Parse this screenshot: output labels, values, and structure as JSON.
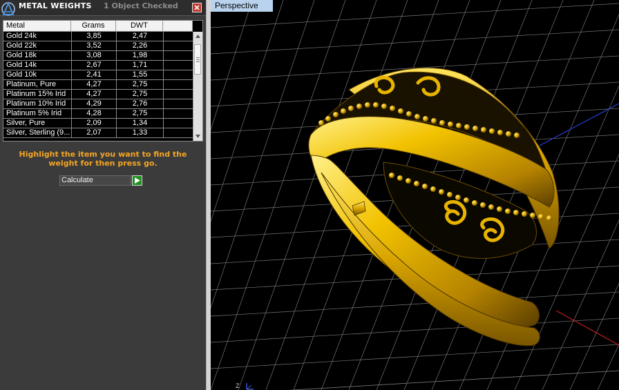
{
  "panel": {
    "title": "METAL WEIGHTS",
    "status": "1 Object Checked",
    "columns": [
      "Metal",
      "Grams",
      "DWT"
    ],
    "rows": [
      {
        "metal": "Gold 24k",
        "grams": "3,85",
        "dwt": "2,47"
      },
      {
        "metal": "Gold 22k",
        "grams": "3,52",
        "dwt": "2,26"
      },
      {
        "metal": "Gold 18k",
        "grams": "3,08",
        "dwt": "1,98"
      },
      {
        "metal": "Gold 14k",
        "grams": "2,67",
        "dwt": "1,71"
      },
      {
        "metal": "Gold 10k",
        "grams": "2,41",
        "dwt": "1,55"
      },
      {
        "metal": "Platinum, Pure",
        "grams": "4,27",
        "dwt": "2,75"
      },
      {
        "metal": "Platinum 15% Irid",
        "grams": "4,27",
        "dwt": "2,75"
      },
      {
        "metal": "Platinum 10% Irid",
        "grams": "4,29",
        "dwt": "2,76"
      },
      {
        "metal": "Platinum 5% Irid",
        "grams": "4,28",
        "dwt": "2,75"
      },
      {
        "metal": "Silver, Pure",
        "grams": "2,09",
        "dwt": "1,34"
      },
      {
        "metal": "Silver, Sterling (9...",
        "grams": "2,07",
        "dwt": "1,33"
      }
    ],
    "instruction": "Highlight the item you want to find the weight for then press go.",
    "calculate_label": "Calculate"
  },
  "viewport": {
    "label": "Perspective",
    "axis_label": "Z"
  },
  "icons": {
    "logo": "app-logo-icon",
    "close": "close-icon",
    "go": "play-arrow-icon",
    "scroll_down": "chevron-down-icon"
  },
  "colors": {
    "instruction": "#f5a623",
    "viewport_label_bg": "#b9d3ee",
    "gold": "#e8b400",
    "grid": "#8f8f8f"
  }
}
